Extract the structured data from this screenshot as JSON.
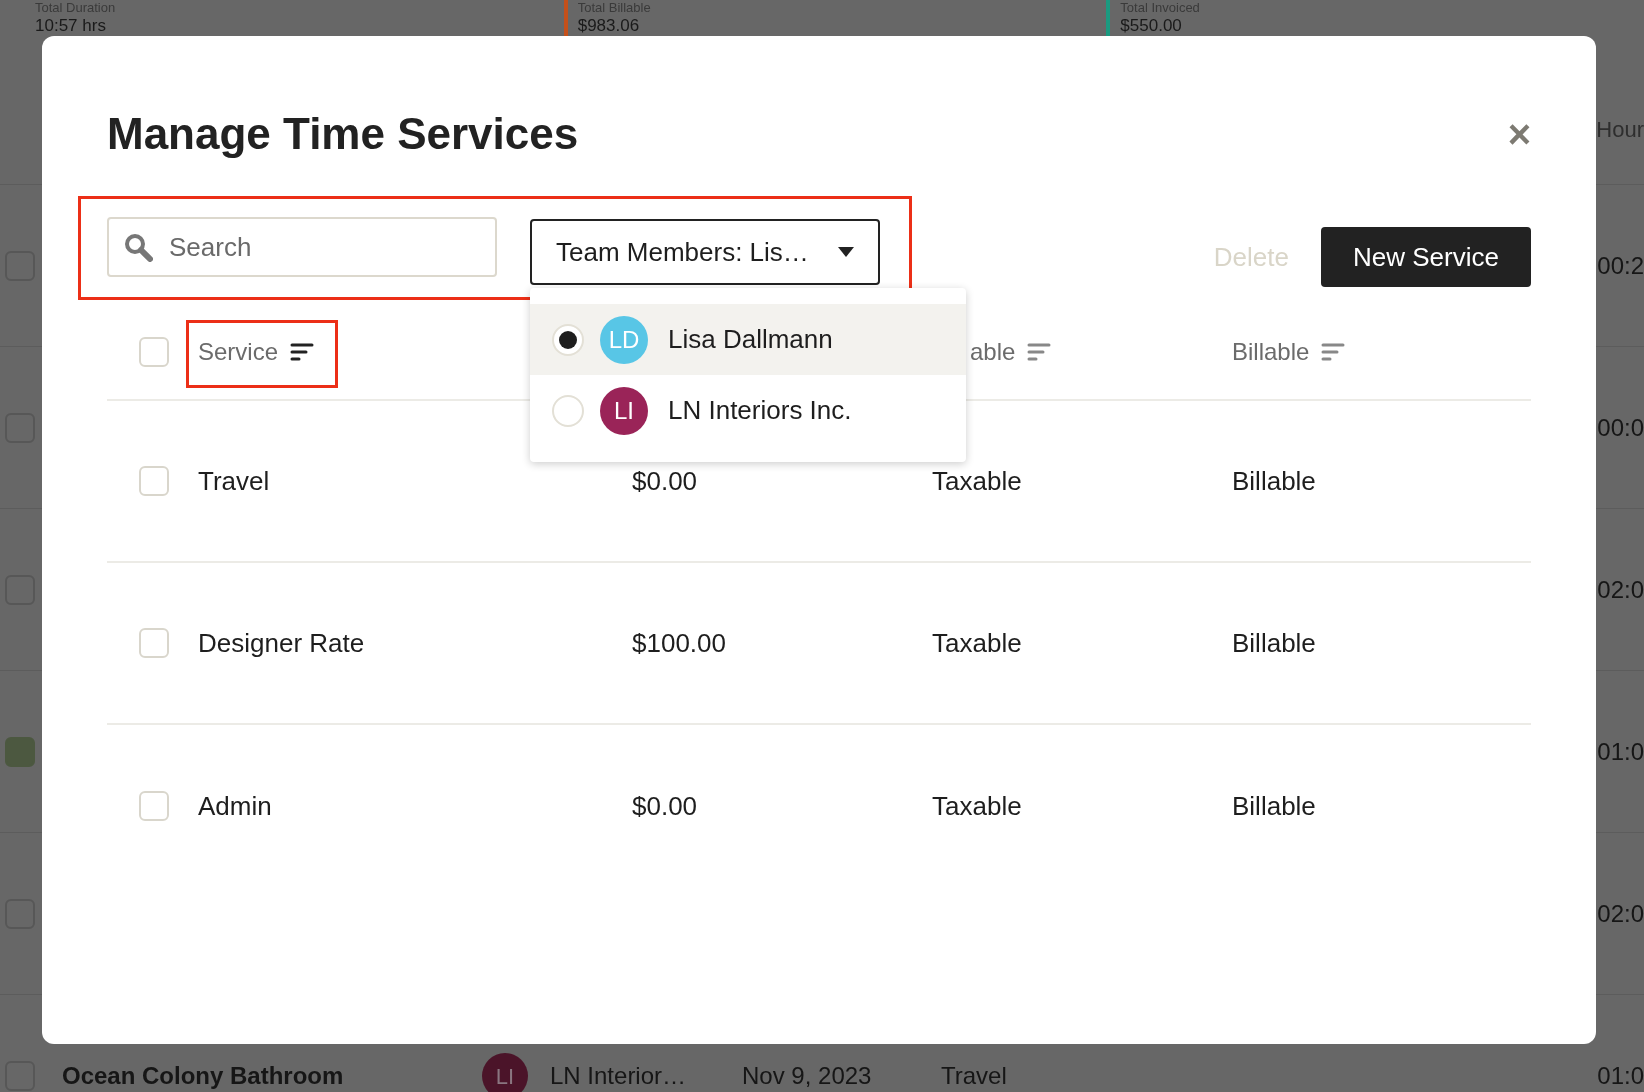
{
  "background": {
    "stats": [
      {
        "label": "Total Duration",
        "value": "10:57 hrs"
      },
      {
        "label": "Total Billable",
        "value": "$983.06",
        "color": "#c4501a"
      },
      {
        "label": "Total Invoiced",
        "value": "$550.00",
        "color": "#1a9a80"
      }
    ],
    "column_header": "Hour",
    "rows": [
      {
        "checked": false,
        "hours": "00:2"
      },
      {
        "checked": false,
        "hours": "00:0"
      },
      {
        "checked": false,
        "hours": "02:0"
      },
      {
        "checked": true,
        "hours": "01:0"
      },
      {
        "checked": false,
        "hours": "02:0"
      },
      {
        "checked": false,
        "project": "Ocean Colony Bathroom",
        "initials": "LI",
        "color": "#4b1429",
        "member": "LN Interior…",
        "date": "Nov 9, 2023",
        "service": "Travel",
        "hours": "01:0"
      }
    ]
  },
  "dialog": {
    "title": "Manage Time Services",
    "close": "×",
    "search": {
      "placeholder": "Search"
    },
    "team_filter": {
      "label": "Team Members: Lis…",
      "expanded": true,
      "options": [
        {
          "initials": "LD",
          "name": "Lisa Dallmann",
          "color": "#58c6e6",
          "selected": true
        },
        {
          "initials": "LI",
          "name": "LN Interiors Inc.",
          "color": "#9a2458",
          "selected": false
        }
      ]
    },
    "delete": {
      "label": "Delete",
      "disabled": true
    },
    "new_service": "New Service",
    "all_checked": false,
    "columns": [
      {
        "label": "Service",
        "sortable": true
      },
      {
        "label": "able",
        "sortable": true
      },
      {
        "label": "Billable",
        "sortable": true
      }
    ],
    "rows": [
      {
        "checked": false,
        "service": "Travel",
        "rate": "$0.00",
        "taxable": "Taxable",
        "billable": "Billable"
      },
      {
        "checked": false,
        "service": "Designer Rate",
        "rate": "$100.00",
        "taxable": "Taxable",
        "billable": "Billable"
      },
      {
        "checked": false,
        "service": "Admin",
        "rate": "$0.00",
        "taxable": "Taxable",
        "billable": "Billable"
      }
    ]
  }
}
